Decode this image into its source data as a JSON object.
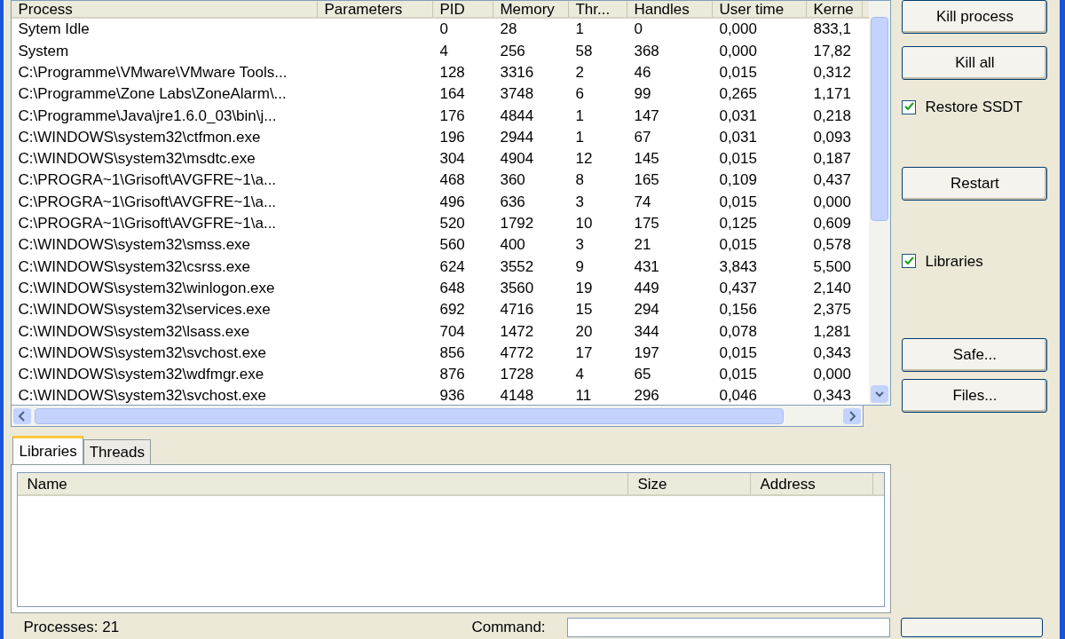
{
  "process_table": {
    "columns": [
      "Process",
      "Parameters",
      "PID",
      "Memory",
      "Thr...",
      "Handles",
      "User time",
      "Kerne"
    ],
    "rows": [
      [
        "Sytem Idle",
        "",
        "0",
        "28",
        "1",
        "0",
        "0,000",
        "833,1"
      ],
      [
        "System",
        "",
        "4",
        "256",
        "58",
        "368",
        "0,000",
        "17,82"
      ],
      [
        "C:\\Programme\\VMware\\VMware Tools...",
        "",
        "128",
        "3316",
        "2",
        "46",
        "0,015",
        "0,312"
      ],
      [
        "C:\\Programme\\Zone Labs\\ZoneAlarm\\...",
        "",
        "164",
        "3748",
        "6",
        "99",
        "0,265",
        "1,171"
      ],
      [
        "C:\\Programme\\Java\\jre1.6.0_03\\bin\\j...",
        "",
        "176",
        "4844",
        "1",
        "147",
        "0,031",
        "0,218"
      ],
      [
        "C:\\WINDOWS\\system32\\ctfmon.exe",
        "",
        "196",
        "2944",
        "1",
        "67",
        "0,031",
        "0,093"
      ],
      [
        "C:\\WINDOWS\\system32\\msdtc.exe",
        "",
        "304",
        "4904",
        "12",
        "145",
        "0,015",
        "0,187"
      ],
      [
        "C:\\PROGRA~1\\Grisoft\\AVGFRE~1\\a...",
        "",
        "468",
        "360",
        "8",
        "165",
        "0,109",
        "0,437"
      ],
      [
        "C:\\PROGRA~1\\Grisoft\\AVGFRE~1\\a...",
        "",
        "496",
        "636",
        "3",
        "74",
        "0,015",
        "0,000"
      ],
      [
        "C:\\PROGRA~1\\Grisoft\\AVGFRE~1\\a...",
        "",
        "520",
        "1792",
        "10",
        "175",
        "0,125",
        "0,609"
      ],
      [
        "C:\\WINDOWS\\system32\\smss.exe",
        "",
        "560",
        "400",
        "3",
        "21",
        "0,015",
        "0,578"
      ],
      [
        "C:\\WINDOWS\\system32\\csrss.exe",
        "",
        "624",
        "3552",
        "9",
        "431",
        "3,843",
        "5,500"
      ],
      [
        "C:\\WINDOWS\\system32\\winlogon.exe",
        "",
        "648",
        "3560",
        "19",
        "449",
        "0,437",
        "2,140"
      ],
      [
        "C:\\WINDOWS\\system32\\services.exe",
        "",
        "692",
        "4716",
        "15",
        "294",
        "0,156",
        "2,375"
      ],
      [
        "C:\\WINDOWS\\system32\\lsass.exe",
        "",
        "704",
        "1472",
        "20",
        "344",
        "0,078",
        "1,281"
      ],
      [
        "C:\\WINDOWS\\system32\\svchost.exe",
        "",
        "856",
        "4772",
        "17",
        "197",
        "0,015",
        "0,343"
      ],
      [
        "C:\\WINDOWS\\system32\\wdfmgr.exe",
        "",
        "876",
        "1728",
        "4",
        "65",
        "0,015",
        "0,000"
      ],
      [
        "C:\\WINDOWS\\system32\\svchost.exe",
        "",
        "936",
        "4148",
        "11",
        "296",
        "0,046",
        "0,343"
      ]
    ]
  },
  "side_controls": [
    {
      "kind": "button",
      "label": "Kill process"
    },
    {
      "kind": "button",
      "label": "Kill all"
    },
    {
      "kind": "checkbox",
      "label": "Restore SSDT",
      "checked": true
    },
    {
      "kind": "button",
      "label": "Restart"
    },
    {
      "kind": "checkbox",
      "label": "Libraries",
      "checked": true
    },
    {
      "kind": "button",
      "label": "Safe..."
    },
    {
      "kind": "button",
      "label": "Files..."
    }
  ],
  "tabs": [
    {
      "label": "Libraries",
      "selected": true
    },
    {
      "label": "Threads",
      "selected": false
    }
  ],
  "libraries_table": {
    "columns": [
      "Name",
      "Size",
      "Address"
    ]
  },
  "status": {
    "processes": "Processes: 21",
    "command_label": "Command:"
  }
}
